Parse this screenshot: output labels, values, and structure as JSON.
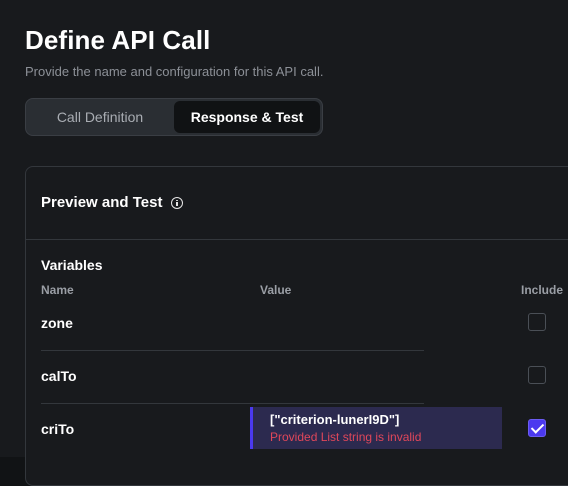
{
  "header": {
    "title": "Define API Call",
    "subtitle": "Provide the name and configuration for this API call."
  },
  "tabs": [
    {
      "label": "Call Definition",
      "active": false
    },
    {
      "label": "Response & Test",
      "active": true
    }
  ],
  "panel": {
    "title": "Preview and Test",
    "info_icon": "info-icon",
    "variables": {
      "title": "Variables",
      "columns": {
        "name": "Name",
        "value": "Value",
        "include": "Include"
      },
      "rows": [
        {
          "name": "zone",
          "value": "",
          "error": "",
          "include": false
        },
        {
          "name": "calTo",
          "value": "",
          "error": "",
          "include": false
        },
        {
          "name": "criTo",
          "value": "[\"criterion-lunerI9D\"]",
          "error": "Provided List string is invalid",
          "include": true
        }
      ]
    }
  },
  "colors": {
    "background": "#181a1d",
    "accent": "#4b39ef",
    "error": "#e0475a",
    "muted_text": "#8c9097"
  }
}
